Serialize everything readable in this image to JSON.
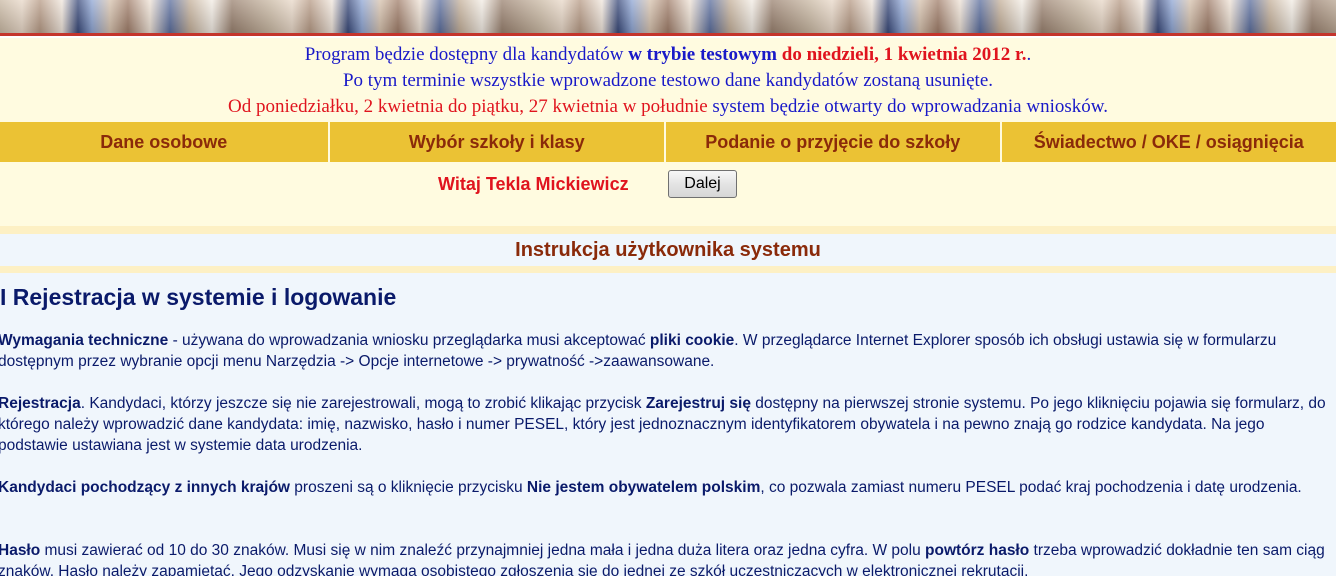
{
  "notice": {
    "line1_a": "Program będzie dostępny dla kandydatów ",
    "line1_b": "w trybie testowym",
    "line1_c": " do niedzieli, 1 kwietnia 2012 r.",
    "line1_d": ".",
    "line2": "Po tym terminie wszystkie wprowadzone testowo dane kandydatów zostaną usunięte.",
    "line3_a": "Od poniedziałku, 2 kwietnia do piątku, 27 kwietnia w południe",
    "line3_b": " system będzie otwarty do wprowadzania wniosków."
  },
  "tabs": [
    {
      "label": "Dane osobowe"
    },
    {
      "label": "Wybór szkoły i klasy"
    },
    {
      "label": "Podanie o przyjęcie do szkoły"
    },
    {
      "label": "Świadectwo / OKE / osiągnięcia"
    }
  ],
  "welcome": {
    "greeting": "Witaj Tekla Mickiewicz",
    "next_button": "Dalej"
  },
  "manual": {
    "title": "Instrukcja użytkownika systemu",
    "section_heading": "I Rejestracja w systemie i logowanie",
    "p1": {
      "b1": "Wymagania techniczne",
      "t1": " - używana do wprowadzania wniosku przeglądarka musi akceptować ",
      "b2": "pliki cookie",
      "t2": ". W przeglądarce Internet Explorer sposób ich obsługi ustawia się w formularzu dostępnym przez wybranie opcji menu Narzędzia -> Opcje internetowe -> prywatność ->zaawansowane."
    },
    "p2": {
      "b1": "Rejestracja",
      "t1": ". Kandydaci, którzy jeszcze się nie zarejestrowali, mogą to zrobić klikając przycisk ",
      "b2": "Zarejestruj się",
      "t2": " dostępny na pierwszej stronie systemu. Po jego kliknięciu pojawia się formularz, do którego należy wprowadzić dane kandydata: imię, nazwisko, hasło i numer PESEL, który jest jednoznacznym identyfikatorem obywatela i na pewno znają go rodzice kandydata. Na jego podstawie ustawiana jest w systemie data urodzenia."
    },
    "p3": {
      "b1": "Kandydaci pochodzący z innych krajów",
      "t1": " proszeni są o kliknięcie przycisku ",
      "b2": "Nie jestem obywatelem polskim",
      "t2": ", co pozwala zamiast numeru PESEL podać kraj pochodzenia i datę urodzenia."
    },
    "p4": {
      "b1": "Hasło",
      "t1": " musi zawierać od 10 do 30 znaków. Musi się w nim znaleźć przynajmniej jedna mała i jedna duża litera oraz jedna cyfra. W polu ",
      "b2": "powtórz hasło",
      "t2": " trzeba wprowadzić dokładnie ten sam ciąg znaków. Hasło należy zapamiętać. Jego odzyskanie wymaga osobistego zgłoszenia się do jednej ze szkół uczestniczących w elektronicznej rekrutacji."
    }
  },
  "colors": {
    "tab_bg": "#ebc234",
    "tab_text": "#8a2a0a",
    "notice_blue": "#1919c8",
    "notice_red": "#e0141e",
    "body_text": "#0a1a6a",
    "page_bg": "#fffbe0",
    "manual_bg": "#f0f6fc"
  }
}
